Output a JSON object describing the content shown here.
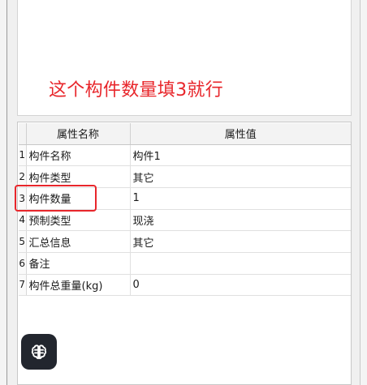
{
  "annotation": {
    "text": "这个构件数量填3就行"
  },
  "properties": {
    "headers": {
      "name": "属性名称",
      "value": "属性值"
    },
    "rows": [
      {
        "index": "1",
        "name": "构件名称",
        "value": "构件1"
      },
      {
        "index": "2",
        "name": "构件类型",
        "value": "其它"
      },
      {
        "index": "3",
        "name": "构件数量",
        "value": "1"
      },
      {
        "index": "4",
        "name": "预制类型",
        "value": "现浇"
      },
      {
        "index": "5",
        "name": "汇总信息",
        "value": "其它"
      },
      {
        "index": "6",
        "name": "备注",
        "value": ""
      },
      {
        "index": "7",
        "name": "构件总重量(kg)",
        "value": "0"
      }
    ]
  },
  "floating_button": {
    "icon": "brain-icon"
  },
  "colors": {
    "annotation": "#e8262b",
    "button_bg": "#22262e"
  }
}
